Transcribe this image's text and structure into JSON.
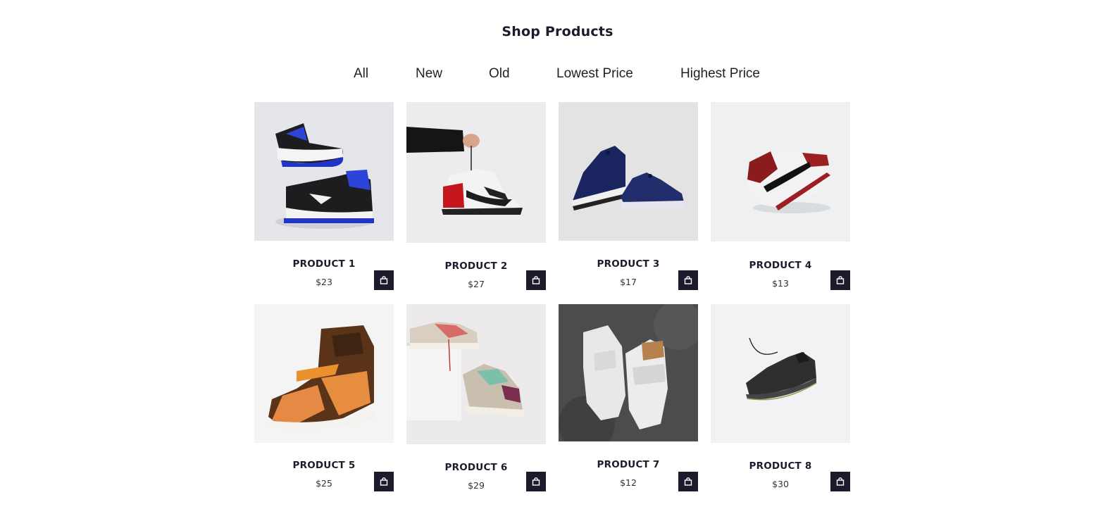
{
  "page_title": "Shop Products",
  "filters": [
    "All",
    "New",
    "Old",
    "Lowest Price",
    "Highest Price"
  ],
  "products": [
    {
      "name": "PRODUCT 1",
      "price": "$23",
      "bg": "#e5e6ea"
    },
    {
      "name": "PRODUCT 2",
      "price": "$27",
      "bg": "#ececee"
    },
    {
      "name": "PRODUCT 3",
      "price": "$17",
      "bg": "#e3e3e3"
    },
    {
      "name": "PRODUCT 4",
      "price": "$13",
      "bg": "#eef0f1"
    },
    {
      "name": "PRODUCT 5",
      "price": "$25",
      "bg": "#f4f4f4"
    },
    {
      "name": "PRODUCT 6",
      "price": "$29",
      "bg": "#eceaea"
    },
    {
      "name": "PRODUCT 7",
      "price": "$12",
      "bg": "#4a4b4d"
    },
    {
      "name": "PRODUCT 8",
      "price": "$30",
      "bg": "#f1f2f3"
    }
  ],
  "cart_icon": "shopping-bag-icon",
  "colors": {
    "dark": "#1b1b2b",
    "text": "#222222"
  }
}
